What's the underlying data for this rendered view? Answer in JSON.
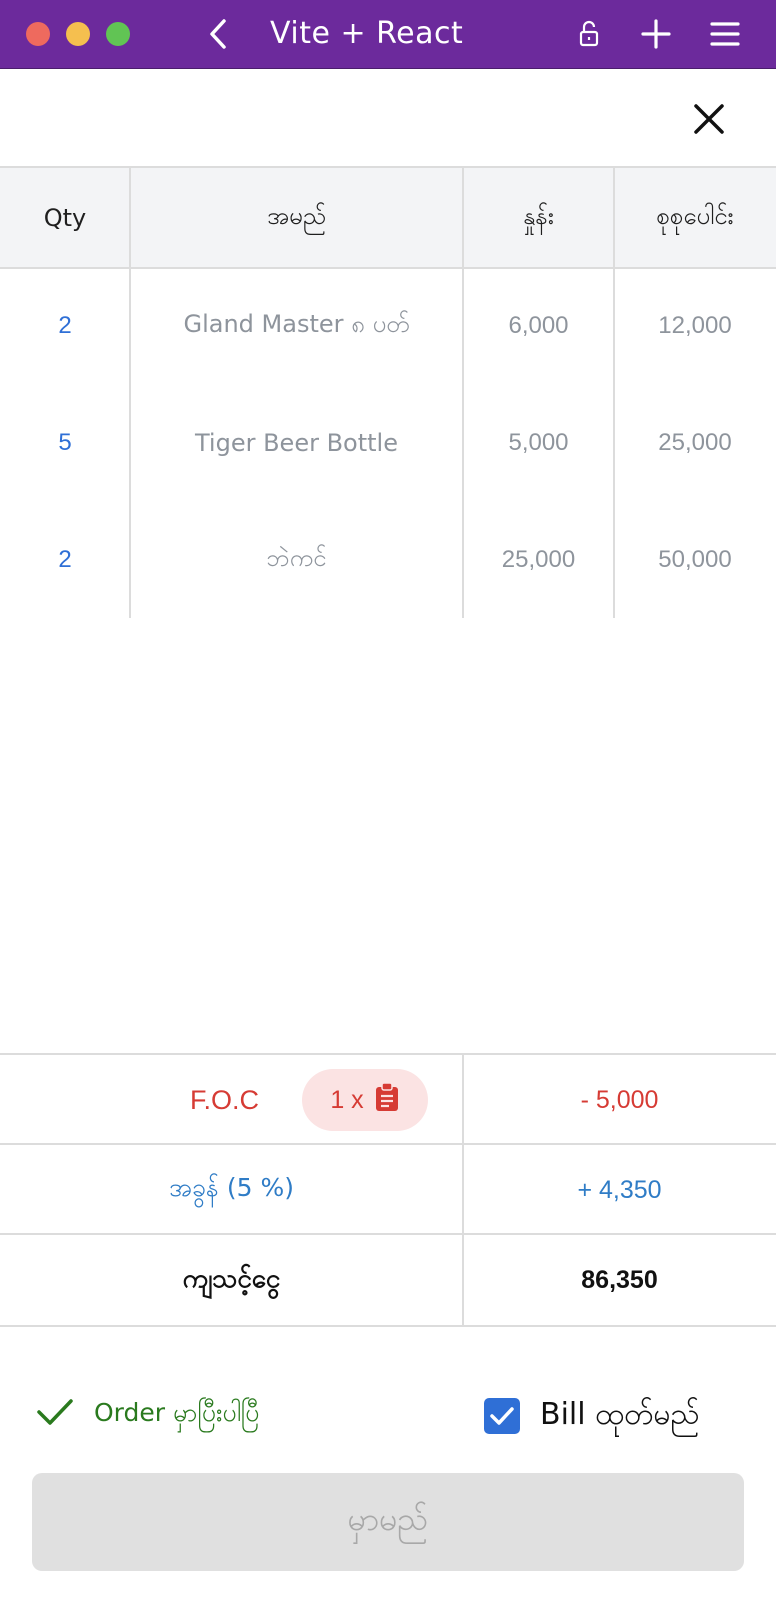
{
  "window": {
    "title": "Vite + React"
  },
  "icons": {
    "back": "chevron-left-icon",
    "lock": "unlock-icon",
    "add": "plus-icon",
    "menu": "hamburger-menu-icon",
    "close": "close-icon",
    "clipboard": "clipboard-icon",
    "check": "check-icon"
  },
  "table": {
    "headers": {
      "qty": "Qty",
      "name": "အမည်",
      "price": "နှုန်း",
      "total": "စုစုပေါင်း"
    },
    "rows": [
      {
        "qty": "2",
        "name": "Gland Master ၈ ပတ်",
        "price": "6,000",
        "total": "12,000"
      },
      {
        "qty": "5",
        "name": "Tiger Beer Bottle",
        "price": "5,000",
        "total": "25,000"
      },
      {
        "qty": "2",
        "name": "ဘဲကင်",
        "price": "25,000",
        "total": "50,000"
      }
    ]
  },
  "summary": {
    "foc_label": "F.O.C",
    "foc_count": "1 x",
    "foc_amount": "- 5,000",
    "tax_label": "အခွန် (5 %)",
    "tax_amount": "+ 4,350",
    "total_label": "ကျသင့်ငွေ",
    "total_amount": "86,350"
  },
  "footer": {
    "order_status": "Order မှာပြီးပါပြီ",
    "bill_label": "Bill ထုတ်မည်",
    "bill_checked": true,
    "pay_button": "မှာမည်"
  },
  "colors": {
    "titlebar": "#6c2a9c",
    "qty_blue": "#2f6fd6",
    "red": "#d63b34",
    "tax_blue": "#2f7cc6",
    "ok_green": "#2a7a1e"
  }
}
